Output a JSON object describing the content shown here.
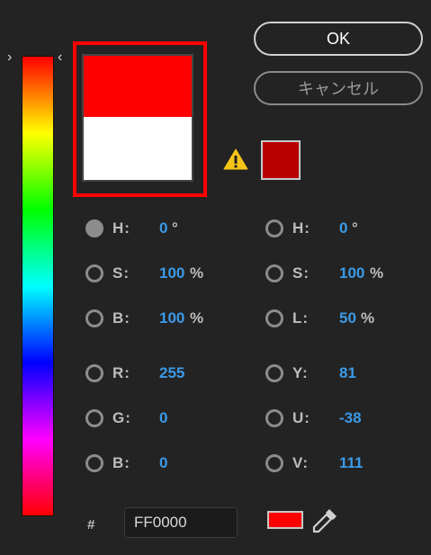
{
  "buttons": {
    "ok_label": "OK",
    "cancel_label": "キャンセル"
  },
  "colors": {
    "new": "#ff0000",
    "old": "#ffffff",
    "gamut_warning": "#b80000",
    "hex_swatch": "#ff0000"
  },
  "slider": {
    "hue": 0,
    "chevron_left": "›",
    "chevron_right": "‹"
  },
  "fields": [
    {
      "key": "hsb-h",
      "label": "H:",
      "value": "0",
      "unit": "°",
      "selected": true
    },
    {
      "key": "hsb-s",
      "label": "S:",
      "value": "100",
      "unit": "%",
      "selected": false
    },
    {
      "key": "hsb-b",
      "label": "B:",
      "value": "100",
      "unit": "%",
      "selected": false
    },
    {
      "key": "rgb-r",
      "label": "R:",
      "value": "255",
      "unit": "",
      "selected": false
    },
    {
      "key": "rgb-g",
      "label": "G:",
      "value": "0",
      "unit": "",
      "selected": false
    },
    {
      "key": "rgb-b",
      "label": "B:",
      "value": "0",
      "unit": "",
      "selected": false
    },
    {
      "key": "hsl-h",
      "label": "H:",
      "value": "0",
      "unit": "°",
      "selected": false
    },
    {
      "key": "hsl-s",
      "label": "S:",
      "value": "100",
      "unit": "%",
      "selected": false
    },
    {
      "key": "hsl-l",
      "label": "L:",
      "value": "50",
      "unit": "%",
      "selected": false
    },
    {
      "key": "yuv-y",
      "label": "Y:",
      "value": "81",
      "unit": "",
      "selected": false
    },
    {
      "key": "yuv-u",
      "label": "U:",
      "value": "-38",
      "unit": "",
      "selected": false
    },
    {
      "key": "yuv-v",
      "label": "V:",
      "value": "111",
      "unit": "",
      "selected": false
    }
  ],
  "hex": {
    "label": "#",
    "value": "FF0000"
  },
  "icons": {
    "warning": "warning-icon",
    "eyedropper": "eyedropper-icon"
  }
}
